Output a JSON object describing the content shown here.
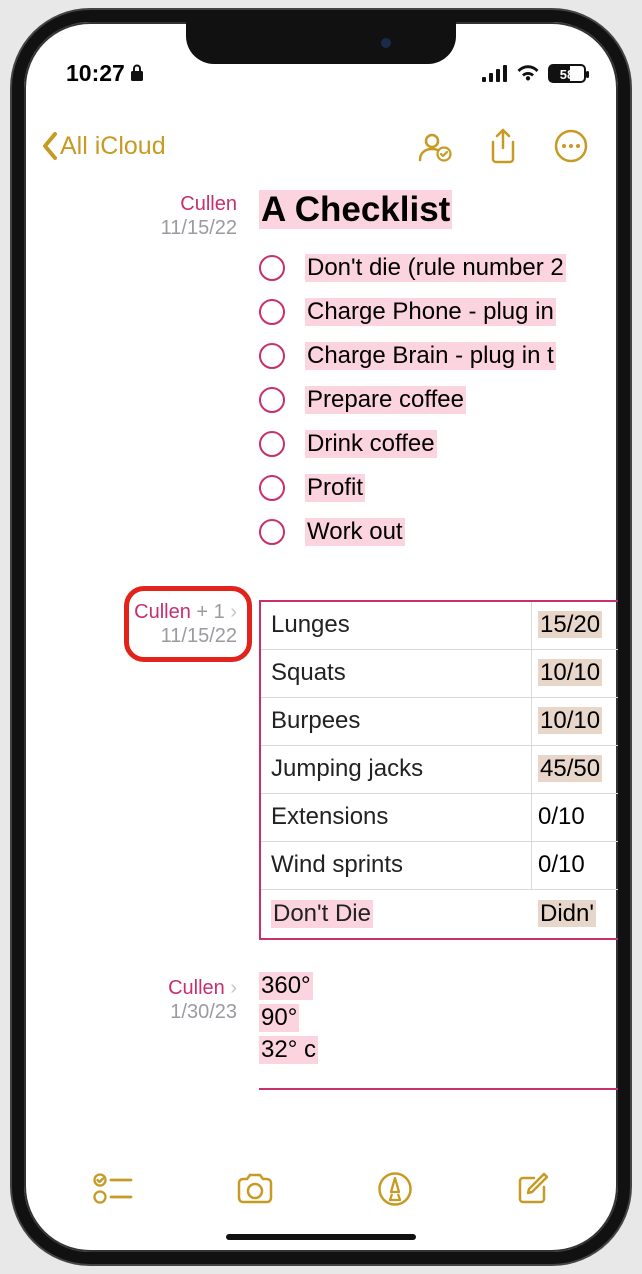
{
  "status": {
    "time": "10:27",
    "battery_pct": "58"
  },
  "nav": {
    "back_label": "All iCloud"
  },
  "sections": {
    "s1": {
      "author": "Cullen",
      "date": "11/15/22",
      "title": "A Checklist",
      "items": [
        "Don't die (rule number 2",
        "Charge Phone - plug in",
        "Charge Brain - plug in t",
        "Prepare coffee",
        "Drink coffee",
        "Profit",
        "Work out"
      ]
    },
    "s2": {
      "author": "Cullen",
      "plus": " + 1 ",
      "date": "11/15/22",
      "rows": [
        {
          "name": "Lunges",
          "val": "15/20"
        },
        {
          "name": "Squats",
          "val": "10/10"
        },
        {
          "name": "Burpees",
          "val": "10/10"
        },
        {
          "name": "Jumping jacks",
          "val": "45/50"
        },
        {
          "name": "Extensions",
          "val": "0/10"
        },
        {
          "name": "Wind sprints",
          "val": "0/10"
        },
        {
          "name": "Don't Die",
          "val": "Didn'"
        }
      ]
    },
    "s3": {
      "author": "Cullen",
      "date": "1/30/23",
      "lines": [
        "360°",
        "90°",
        "32° c"
      ]
    }
  }
}
